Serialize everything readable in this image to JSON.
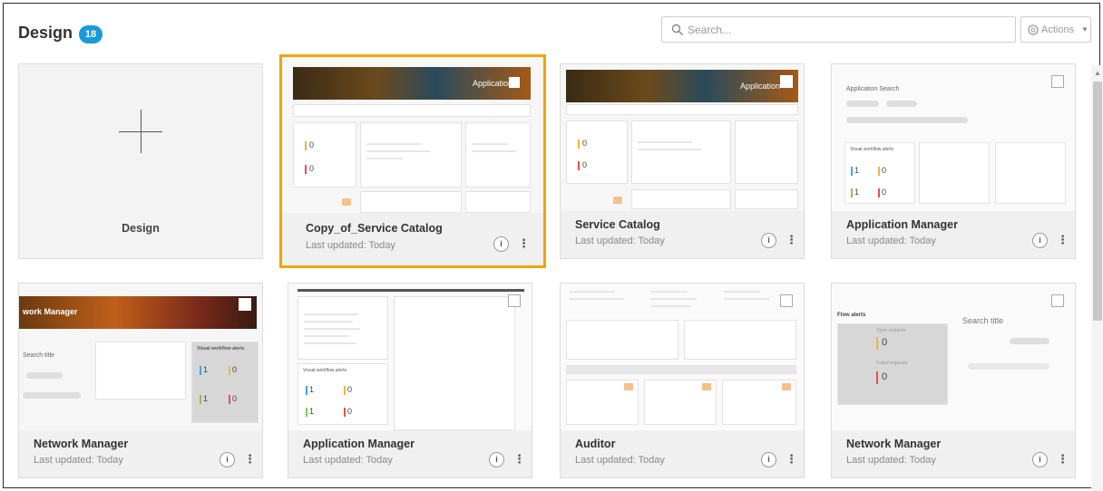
{
  "header": {
    "title": "Design",
    "count": "18",
    "search_placeholder": "Search...",
    "actions_label": "Actions"
  },
  "add_card": {
    "label": "Design"
  },
  "cards": [
    {
      "name": "Copy_of_Service Catalog",
      "updated": "Last updated: Today",
      "selected": true
    },
    {
      "name": "Service Catalog",
      "updated": "Last updated: Today"
    },
    {
      "name": "Application Manager",
      "updated": "Last updated: Today"
    },
    {
      "name": "Network Manager",
      "updated": "Last updated: Today"
    },
    {
      "name": "Application Manager",
      "updated": "Last updated: Today"
    },
    {
      "name": "Auditor",
      "updated": "Last updated: Today"
    },
    {
      "name": "Network Manager",
      "updated": "Last updated: Today"
    }
  ],
  "thumbs": {
    "banner_app": "Application",
    "app_search": "Application Search",
    "visual_alerts": "Visual workflow alerts",
    "network_banner": "work Manager",
    "flow_alerts": "Flow alerts",
    "search_title": "Search title",
    "open_requests": "Open requests",
    "failed_requests": "Failed requests",
    "n1": "1",
    "n0": "0"
  },
  "colors": {
    "accent": "#1a9ad9",
    "selected_border": "#f0a500",
    "bar_yellow": "#f3b43a",
    "bar_red": "#e5534b",
    "bar_blue": "#3da6dd",
    "bar_green": "#8cc152"
  }
}
